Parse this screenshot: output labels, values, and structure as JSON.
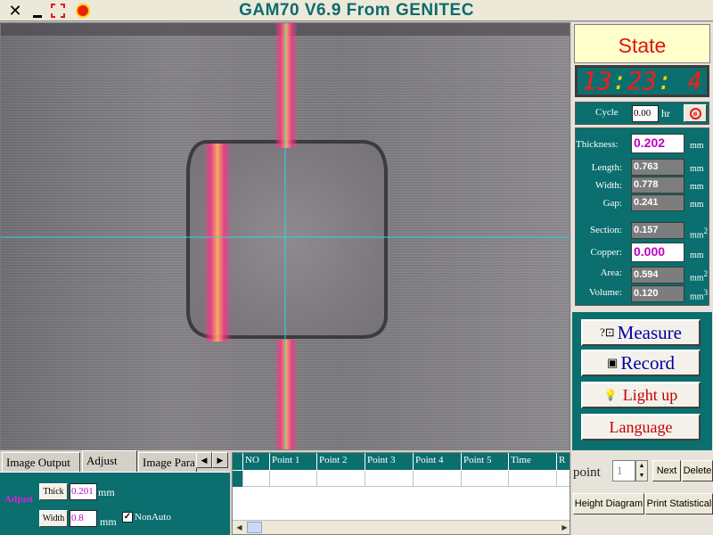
{
  "window": {
    "title": "GAM70  V6.9  From  GENITEC",
    "close_glyph": "✕",
    "max_glyph": "⛶"
  },
  "state": {
    "label": "State",
    "clock": {
      "hours": "13",
      "minutes": "23",
      "seconds": " 4",
      "separator": ":"
    }
  },
  "cycle": {
    "label": "Cycle",
    "value": "0.00",
    "unit": "hr"
  },
  "measurements": {
    "thickness": {
      "label": "Thickness:",
      "value": "0.202",
      "unit": "mm"
    },
    "length": {
      "label": "Length:",
      "value": "0.763",
      "unit": "mm"
    },
    "width": {
      "label": "Width:",
      "value": "0.778",
      "unit": "mm"
    },
    "gap": {
      "label": "Gap:",
      "value": "0.241",
      "unit": "mm"
    },
    "section": {
      "label": "Section:",
      "value": "0.157",
      "unit": "mm",
      "exp": "2"
    },
    "copper": {
      "label": "Copper:",
      "value": "0.000",
      "unit": "mm"
    },
    "area": {
      "label": "Area:",
      "value": "0.594",
      "unit": "mm",
      "exp": "2"
    },
    "volume": {
      "label": "Volume:",
      "value": "0.120",
      "unit": "mm",
      "exp": "3"
    }
  },
  "actions": {
    "measure": "Measure",
    "record": "Record",
    "light_up": "Light up",
    "language": "Language",
    "measure_icon": "?⊡",
    "record_icon": "▣",
    "light_icon": "💡"
  },
  "point": {
    "label": "point",
    "value": "1",
    "next": "Next",
    "delete": "Delete",
    "height_diagram": "Height Diagram",
    "print_statistical": "Print Statistical"
  },
  "tabs": {
    "items": [
      "Image Output",
      "Adjust",
      "Image Para"
    ],
    "active": "Adjust",
    "left_arrow": "◀",
    "right_arrow": "▶"
  },
  "adjust": {
    "label": "Adjust",
    "thick_button": "Thick",
    "thick_value": "0.201",
    "width_button": "Width",
    "width_value": "0.8",
    "unit": "mm",
    "nonauto_label": "NonAuto",
    "nonauto_checked": "✓"
  },
  "table": {
    "columns": [
      "NO",
      "Point 1",
      "Point 2",
      "Point 3",
      "Point 4",
      "Point 5",
      "Time",
      "R"
    ]
  },
  "colors": {
    "panel_teal": "#0a6f6e",
    "state_red": "#e0140f",
    "button_blue": "#0000a8",
    "highlight_magenta": "#c000c0"
  }
}
